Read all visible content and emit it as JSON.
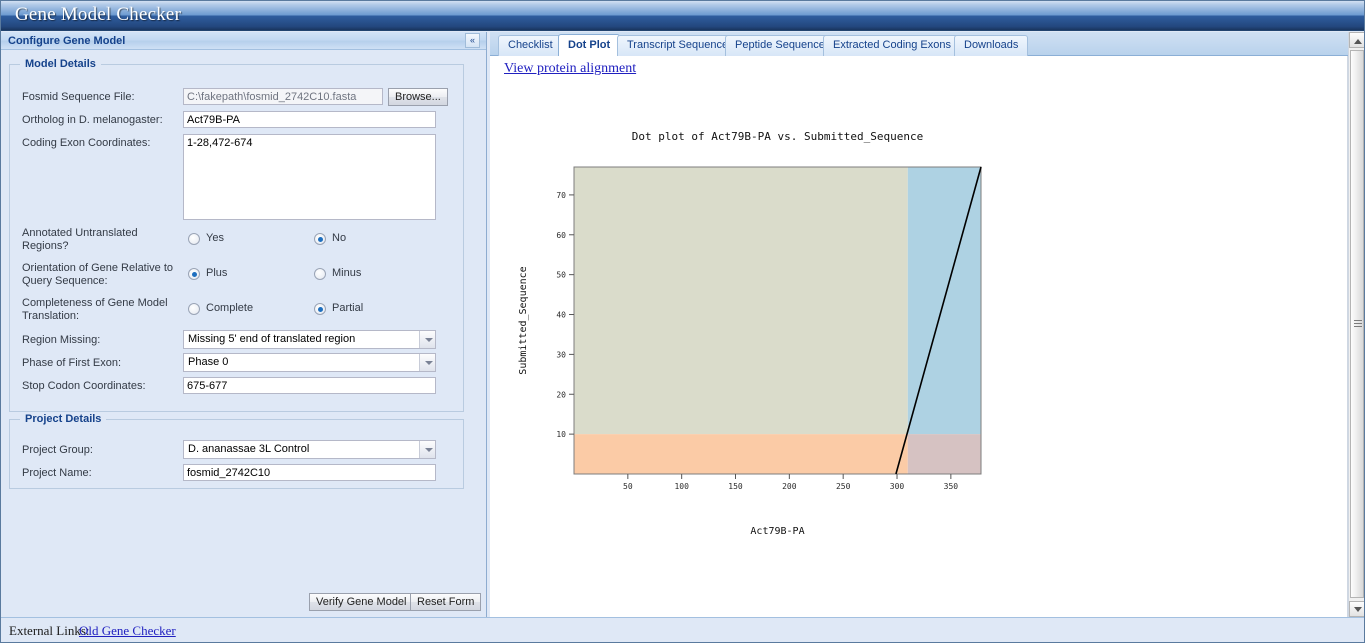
{
  "window": {
    "title": "Gene Model Checker"
  },
  "left_panel": {
    "header_label": "Configure Gene Model",
    "collapse_icon": "«",
    "model_details": {
      "legend": "Model Details",
      "fosmid_label": "Fosmid Sequence File:",
      "fosmid_value": "C:\\fakepath\\fosmid_2742C10.fasta",
      "browse_label": "Browse...",
      "ortholog_label": "Ortholog in D. melanogaster:",
      "ortholog_value": "Act79B-PA",
      "exons_label": "Coding Exon Coordinates:",
      "exons_value": "1-28,472-674",
      "utr_label": "Annotated Untranslated Regions?",
      "utr_yes": "Yes",
      "utr_no": "No",
      "utr_selected": "No",
      "orientation_label": "Orientation of Gene Relative to Query Sequence:",
      "orientation_plus": "Plus",
      "orientation_minus": "Minus",
      "orientation_selected": "Plus",
      "completeness_label": "Completeness of Gene Model Translation:",
      "completeness_complete": "Complete",
      "completeness_partial": "Partial",
      "completeness_selected": "Partial",
      "region_missing_label": "Region Missing:",
      "region_missing_value": "Missing 5' end of translated region",
      "phase_label": "Phase of First Exon:",
      "phase_value": "Phase 0",
      "stop_codon_label": "Stop Codon Coordinates:",
      "stop_codon_value": "675-677"
    },
    "project_details": {
      "legend": "Project Details",
      "group_label": "Project Group:",
      "group_value": "D. ananassae 3L Control",
      "name_label": "Project Name:",
      "name_value": "fosmid_2742C10"
    },
    "buttons": {
      "verify_label": "Verify Gene Model",
      "reset_label": "Reset Form"
    }
  },
  "right_panel": {
    "tabs": [
      {
        "label": "Checklist",
        "active": false
      },
      {
        "label": "Dot Plot",
        "active": true
      },
      {
        "label": "Transcript Sequence",
        "active": false
      },
      {
        "label": "Peptide Sequence",
        "active": false
      },
      {
        "label": "Extracted Coding Exons",
        "active": false
      },
      {
        "label": "Downloads",
        "active": false
      }
    ],
    "protein_alignment_link": "View protein alignment"
  },
  "footer": {
    "external_links_label": "External Links:",
    "old_gene_checker_link": "Old Gene Checker"
  },
  "chart_data": {
    "type": "line",
    "title": "Dot plot of Act79B-PA vs. Submitted_Sequence",
    "xlabel": "Act79B-PA",
    "ylabel": "Submitted_Sequence",
    "xlim": [
      0,
      378
    ],
    "ylim": [
      0,
      77
    ],
    "xticks": [
      50,
      100,
      150,
      200,
      250,
      300,
      350
    ],
    "yticks": [
      10,
      20,
      30,
      40,
      50,
      60,
      70
    ],
    "grid": false,
    "legend": null,
    "series": [
      {
        "name": "alignment-diagonal",
        "color": "#000000",
        "x": [
          299,
          378
        ],
        "y": [
          0,
          77
        ]
      }
    ],
    "regions": [
      {
        "name": "upper-left-unaligned",
        "color": "#dadccb",
        "x0": 0,
        "x1": 310,
        "y0": 10,
        "y1": 77
      },
      {
        "name": "upper-right-aligned",
        "color": "#aed2e3",
        "x0": 310,
        "x1": 378,
        "y0": 10,
        "y1": 77
      },
      {
        "name": "lower-left-missing",
        "color": "#fbcba6",
        "x0": 0,
        "x1": 310,
        "y0": 0,
        "y1": 10
      },
      {
        "name": "lower-right-overlap",
        "color": "#d6c2c2",
        "x0": 310,
        "x1": 378,
        "y0": 0,
        "y1": 10
      }
    ]
  }
}
